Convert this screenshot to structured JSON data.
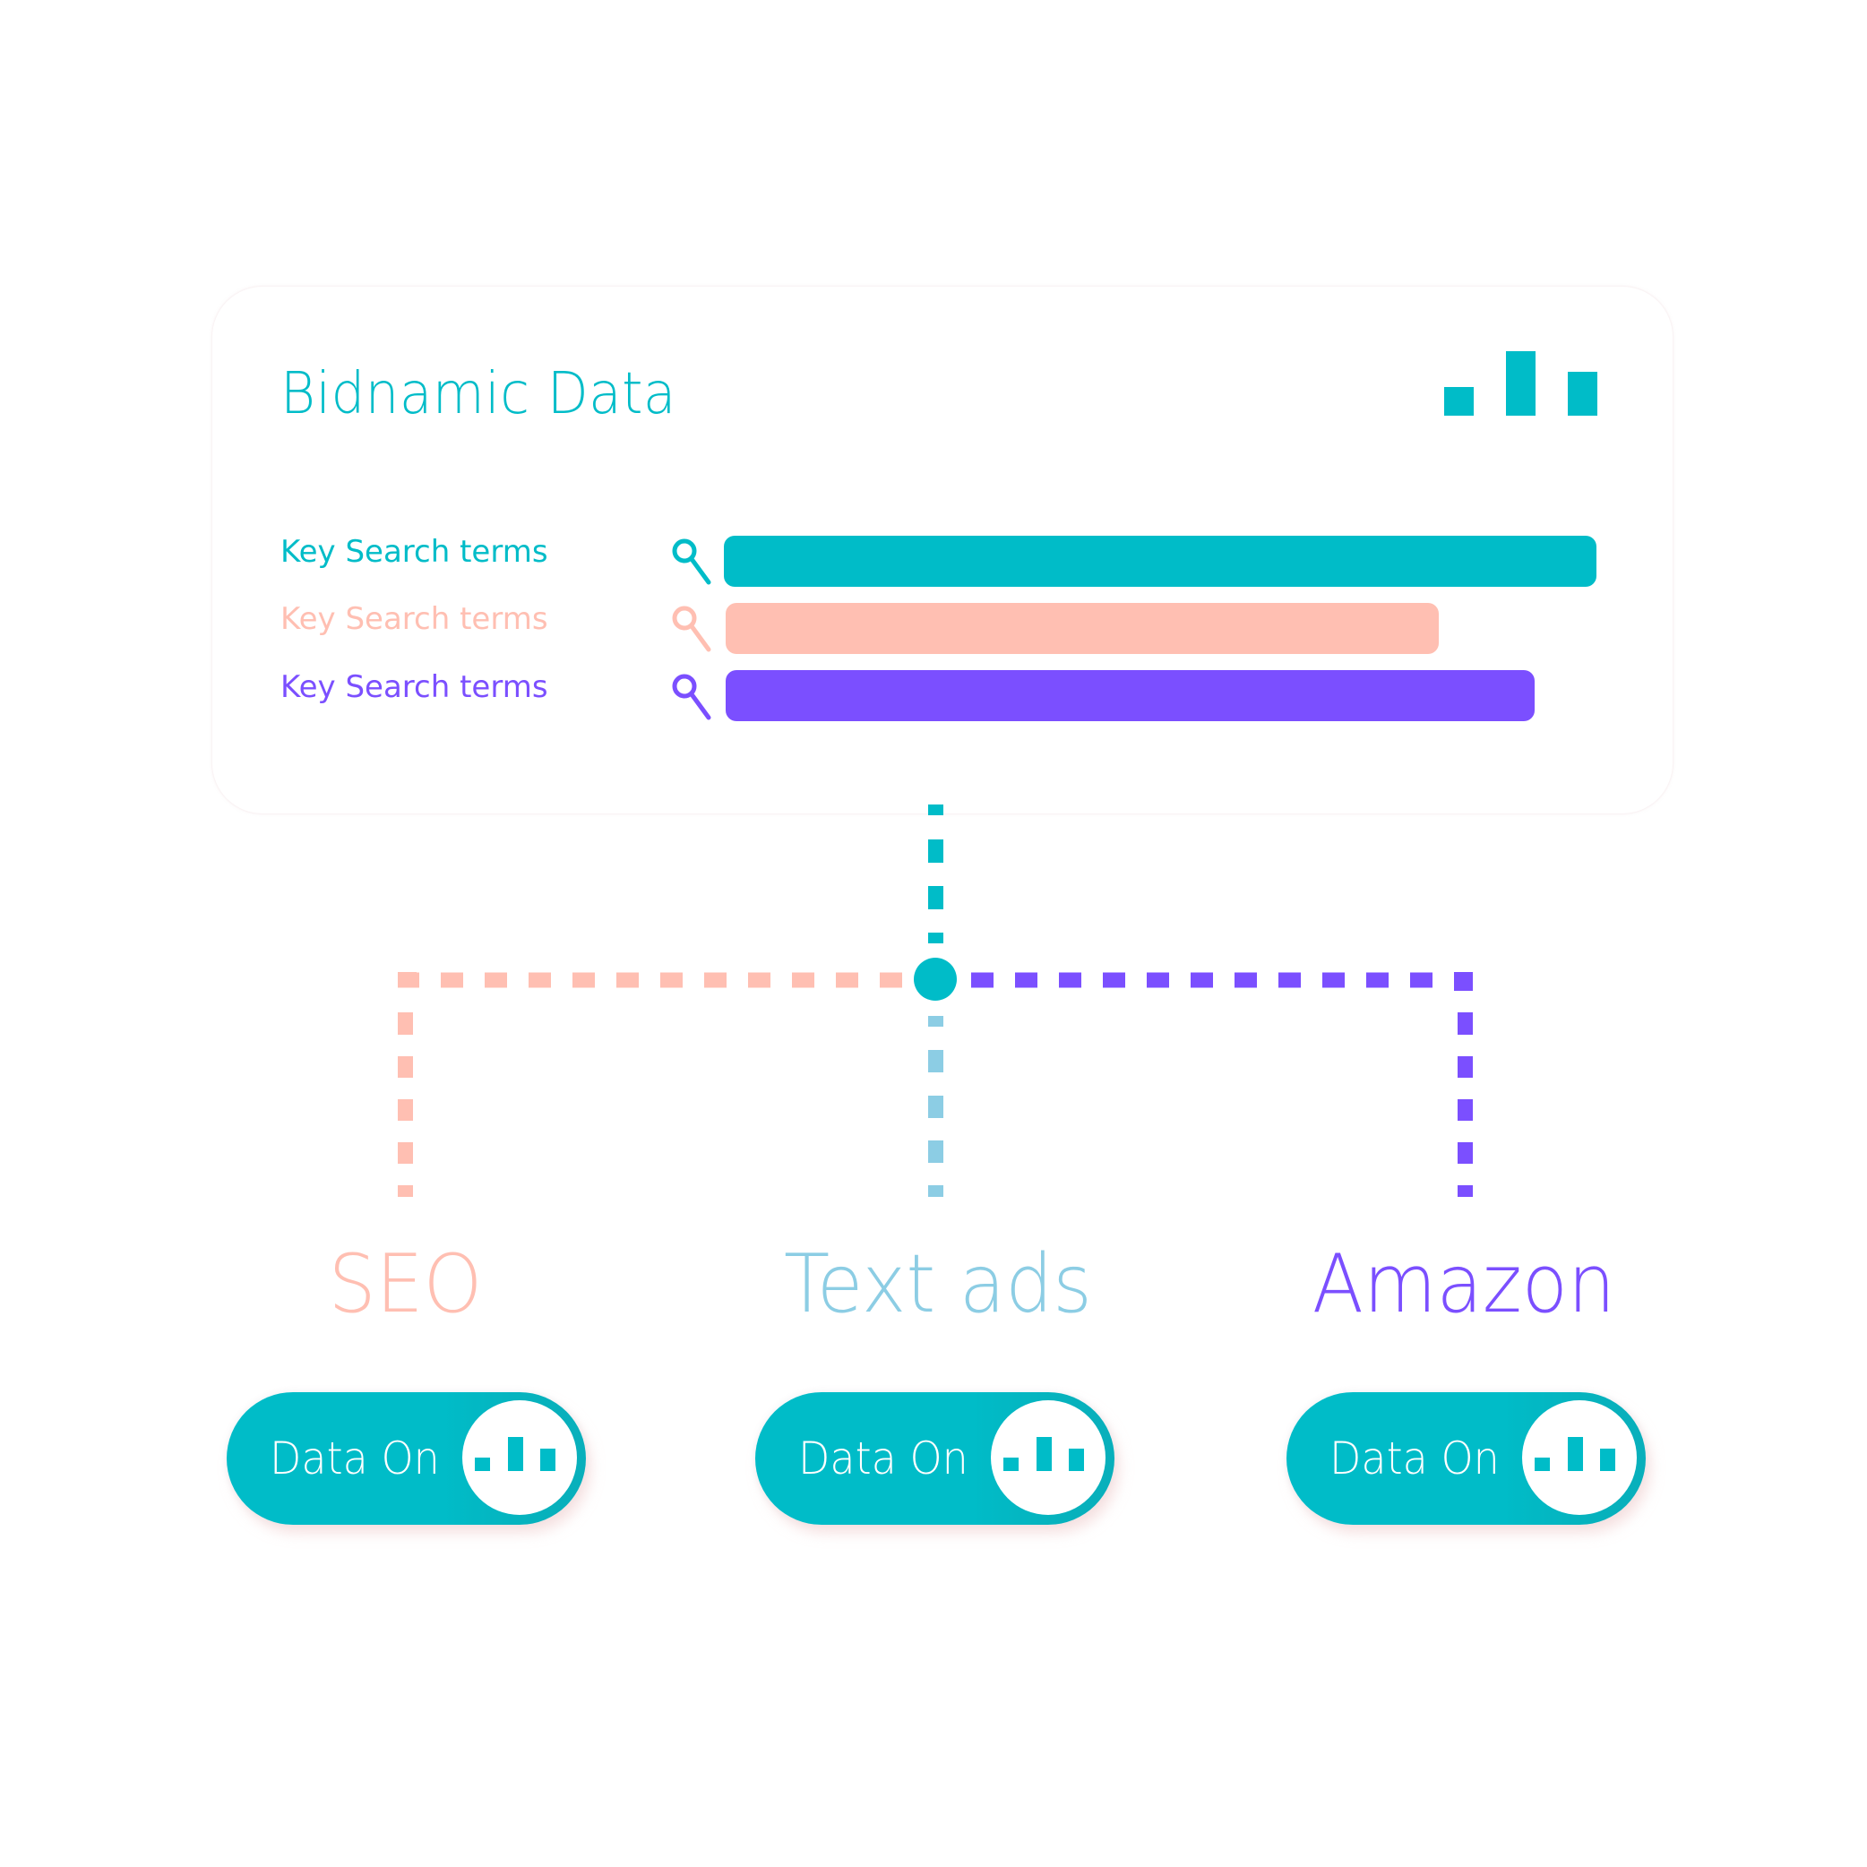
{
  "colors": {
    "teal": "#00bcc8",
    "peach": "#ffbfb2",
    "purple": "#7b4fff",
    "light_blue": "#8ccde4",
    "white": "#ffffff"
  },
  "card": {
    "title": "Bidnamic Data",
    "title_icon": "bar-chart-icon",
    "rows": [
      {
        "label": "Key Search terms",
        "icon": "search-icon",
        "color": "#00bcc8",
        "bar_value": 1.0
      },
      {
        "label": "Key Search terms",
        "icon": "search-icon",
        "color": "#ffbfb2",
        "bar_value": 0.817
      },
      {
        "label": "Key Search terms",
        "icon": "search-icon",
        "color": "#7b4fff",
        "bar_value": 0.927
      }
    ]
  },
  "channels": [
    {
      "name": "SEO",
      "color": "#ffbfb2",
      "toggle_label": "Data On",
      "toggle_icon": "bar-chart-icon",
      "toggle_on": true
    },
    {
      "name": "Text ads",
      "color": "#8ccde4",
      "toggle_label": "Data On",
      "toggle_icon": "bar-chart-icon",
      "toggle_on": true
    },
    {
      "name": "Amazon",
      "color": "#7b4fff",
      "toggle_label": "Data On",
      "toggle_icon": "bar-chart-icon",
      "toggle_on": true
    }
  ]
}
